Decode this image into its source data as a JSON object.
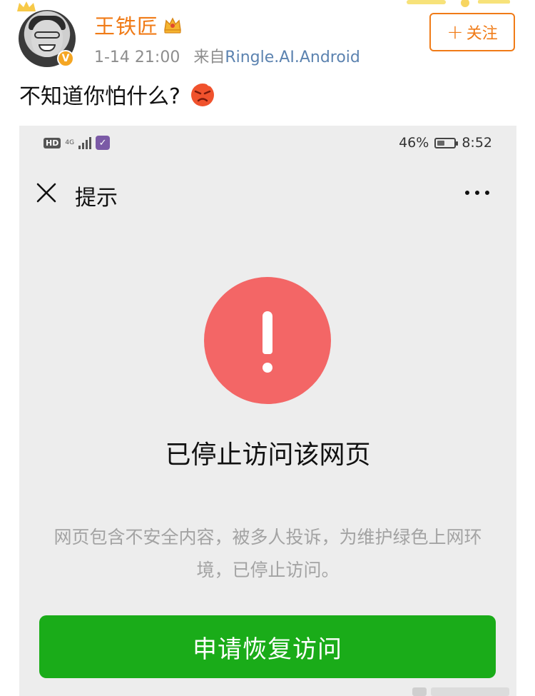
{
  "post": {
    "username": "王铁匠",
    "meta_time": "1-14 21:00",
    "meta_from": "来自",
    "meta_source": "Ringle.AI.Android",
    "follow_label": "关注",
    "text": "不知道你怕什么?",
    "verified_badge": "V"
  },
  "icons": {
    "avatar": "user-avatar-photo",
    "vip": "crown-vip-icon",
    "verified": "verified-v-icon",
    "emoji": "angry-face-emoji",
    "plus": "plus-icon"
  },
  "phone": {
    "status": {
      "hd": "HD",
      "network": "4G",
      "app_badge": "✓",
      "battery_text": "46%",
      "battery_level": 0.46,
      "time": "8:52"
    },
    "nav": {
      "title": "提示"
    },
    "alert": {
      "headline": "已停止访问该网页",
      "description": "网页包含不安全内容，被多人投诉，为维护绿色上网环境，已停止访问。",
      "button_label": "申请恢复访问"
    }
  },
  "colors": {
    "brand_orange": "#f07b17",
    "source_blue": "#5c83b0",
    "warning_red": "#f36666",
    "button_green": "#1aac19",
    "page_gray": "#ededed"
  }
}
